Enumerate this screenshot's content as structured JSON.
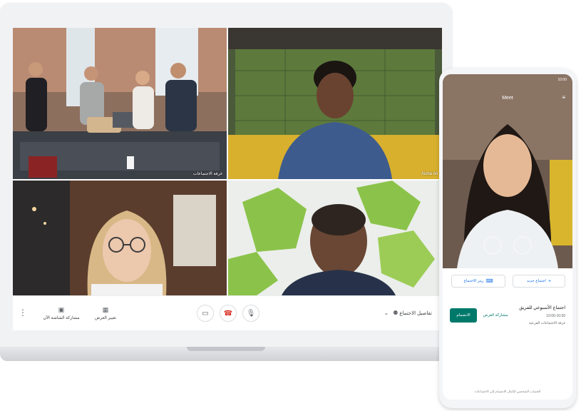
{
  "laptop": {
    "tiles": [
      {
        "label": ""
      },
      {
        "label": "Aisha Ali"
      },
      {
        "label": ""
      },
      {
        "label": ""
      }
    ],
    "group_tile_label": "غرفة الاجتماعات",
    "controls": {
      "present_label": "مشاركة الشاشة الآن",
      "layout_label": "تغيير العرض",
      "meeting_details_label": "تفاصيل الاجتماع",
      "end_icon": "phone-hangup-icon",
      "mic_icon": "microphone-icon",
      "camera_icon": "camera-icon"
    }
  },
  "phone": {
    "status_time": "10:00",
    "app_title": "Meet",
    "buttons": {
      "new_meeting": "اجتماع جديد",
      "join_with_code": "رمز الاجتماع"
    },
    "meeting": {
      "name": "اجتماع الأسبوعي للفريق",
      "time": "10:00-10:30",
      "type": "غرفة الاجتماعات الفرعية",
      "join_label": "الانضمام",
      "present_label": "مشاركة العرض"
    },
    "footer_note": "الحساب الشخصي لإكمال الانضمام إلى الاجتماعات"
  },
  "colors": {
    "accent_green": "#00796b",
    "link_blue": "#1a73e8",
    "end_call_red": "#d93025",
    "lime_shape": "#8bc34a"
  }
}
